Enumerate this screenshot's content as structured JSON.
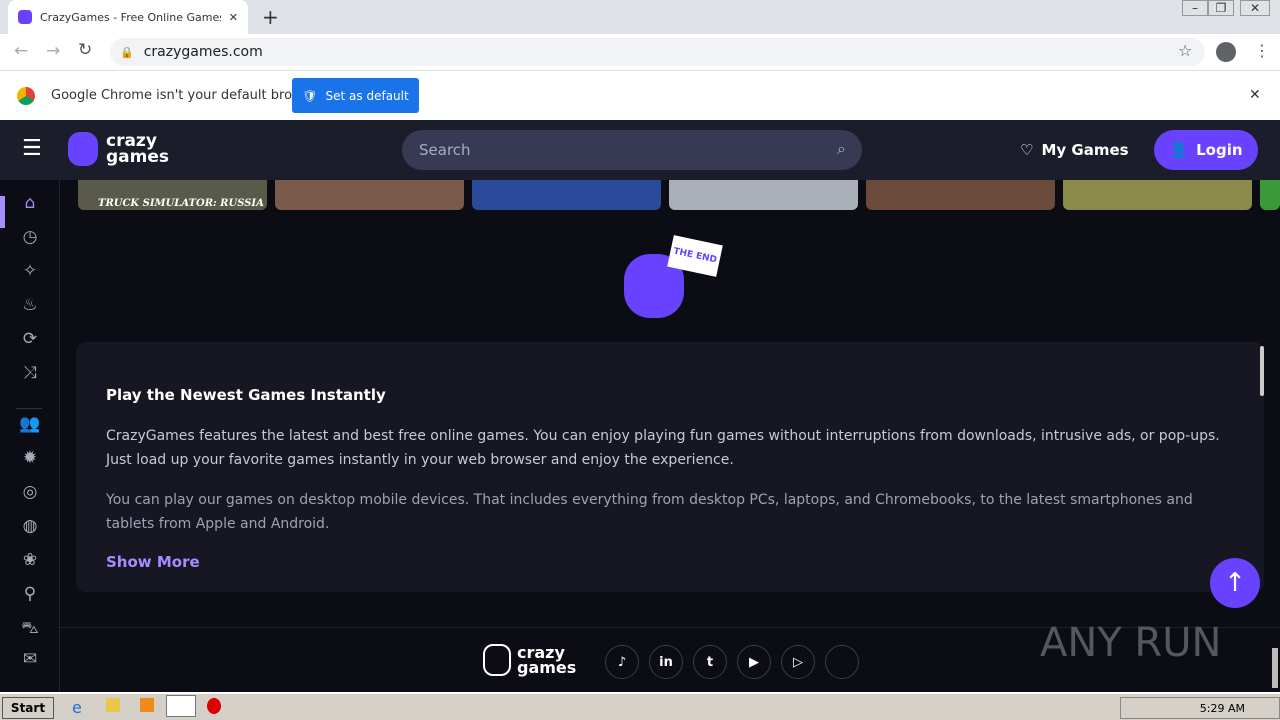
{
  "browser": {
    "tab_title": "CrazyGames - Free Online Games on",
    "url": "crazygames.com",
    "infobar_text": "Google Chrome isn't your default browser",
    "set_default": "Set as default"
  },
  "header": {
    "logo_line1": "crazy",
    "logo_line2": "games",
    "search_placeholder": "Search",
    "my_games": "My Games",
    "login": "Login"
  },
  "thumbs": [
    {
      "label": "TRUCK SIMULATOR: RUSSIA",
      "color": "#5a5a4a"
    },
    {
      "label": "",
      "color": "#7a5a4a"
    },
    {
      "label": "",
      "color": "#2a4a9a"
    },
    {
      "label": "",
      "color": "#aab0b8"
    },
    {
      "label": "",
      "color": "#6a4a3a"
    },
    {
      "label": "",
      "color": "#8a8a4a"
    },
    {
      "label": "",
      "color": "#3a9a3a"
    }
  ],
  "end_badge": "THE END",
  "sidebar": [
    "home-icon",
    "clock-icon",
    "sparkle-icon",
    "fire-icon",
    "refresh-icon",
    "shuffle-icon",
    "multiplayer-icon",
    "action-icon",
    "compass-icon",
    "basketball-icon",
    "flower-icon",
    "bike-icon",
    "car-icon",
    "mail-icon"
  ],
  "content": {
    "title": "Play the Newest Games Instantly",
    "p1": "CrazyGames features the latest and best free online games. You can enjoy playing fun games without interruptions from downloads, intrusive ads, or pop-ups. Just load up your favorite games instantly in your web browser and enjoy the experience.",
    "p2": "You can play our games on desktop mobile devices. That includes everything from desktop PCs, laptops, and Chromebooks, to the latest smartphones and tablets from Apple and Android.",
    "show_more": "Show More"
  },
  "footer": {
    "logo_line1": "crazy",
    "logo_line2": "games",
    "social": [
      "tiktok-icon",
      "linkedin-icon",
      "twitter-icon",
      "youtube-icon",
      "google-play-icon",
      "apple-icon"
    ]
  },
  "watermark": "ANY RUN",
  "taskbar": {
    "start": "Start",
    "clock": "5:29 AM"
  },
  "colors": {
    "accent": "#6842ff",
    "link": "#a68cff"
  }
}
